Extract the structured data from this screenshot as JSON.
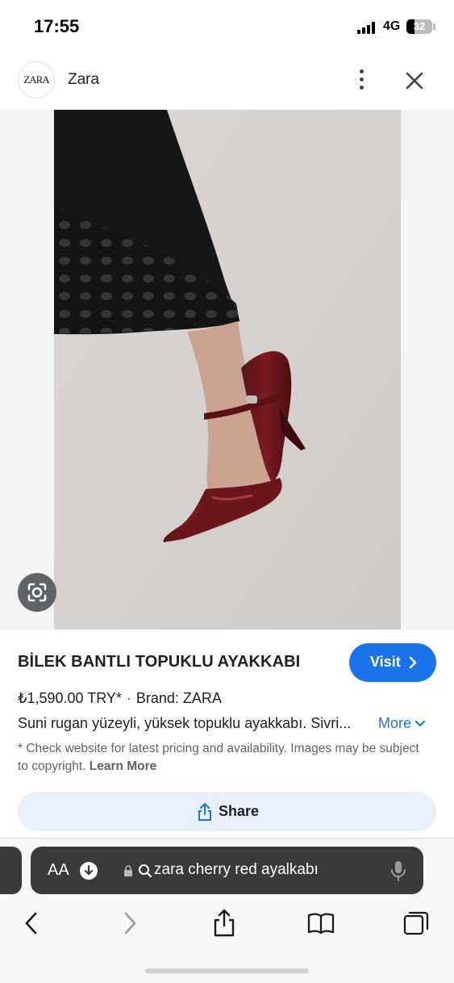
{
  "status_bar": {
    "time": "17:55",
    "network": "4G",
    "battery": "32",
    "battery_level": 0.32
  },
  "header": {
    "logo_text": "ZARA",
    "site_name": "Zara",
    "menu_icon": "more-vertical-icon",
    "close_icon": "close-icon"
  },
  "image": {
    "lens_icon": "google-lens-icon"
  },
  "product": {
    "title": "BİLEK BANTLI TOPUKLU AYAKKABI",
    "visit_label": "Visit",
    "price": "₺1,590.00 TRY*",
    "separator": "·",
    "brand": "Brand: ZARA",
    "description": "Suni rugan yüzeyli, yüksek topuklu ayakkabı. Sivri...",
    "more_label": "More",
    "disclaimer": "* Check website for latest pricing and availability. Images may be subject to copyright.",
    "learn_more": "Learn More",
    "share_label": "Share"
  },
  "browser": {
    "aa_label": "AA",
    "url": "zara cherry red ayalkabı",
    "toolbar": [
      "back-icon",
      "forward-icon",
      "share-icon",
      "bookmarks-icon",
      "tabs-icon"
    ]
  },
  "colors": {
    "accent": "#1a73e8",
    "share_bg": "#e8f0fe",
    "address_bar": "#3a3a3c"
  }
}
